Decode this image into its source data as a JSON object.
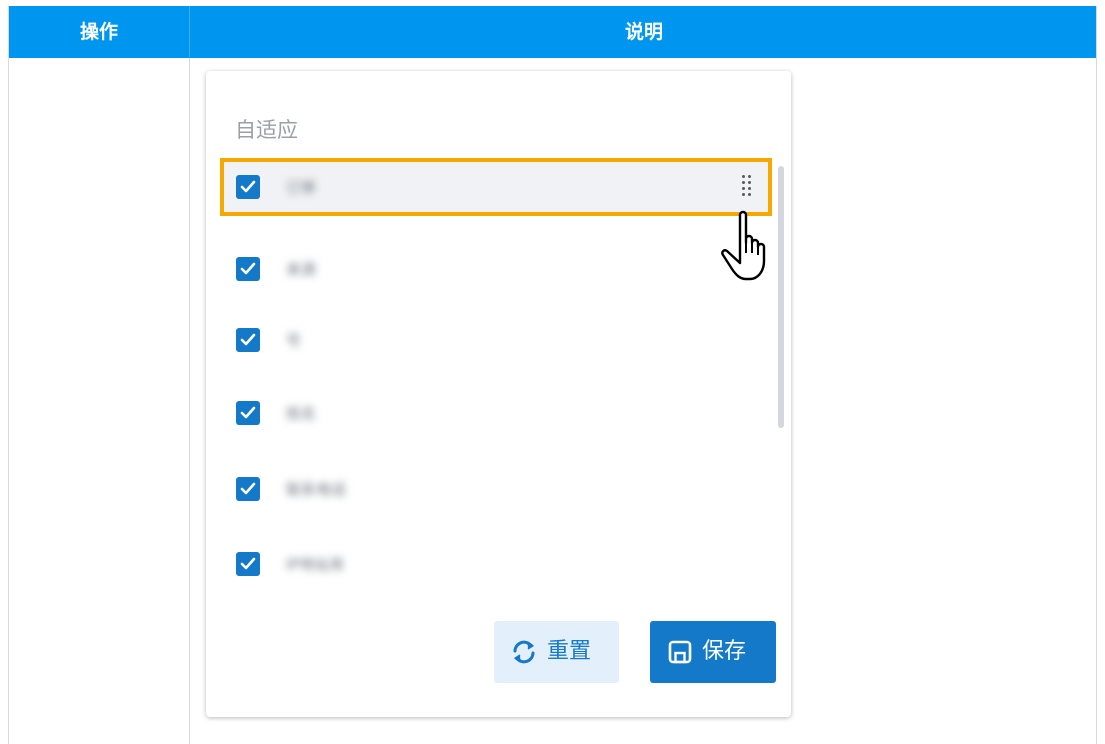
{
  "table": {
    "headers": [
      "操作",
      "说明"
    ]
  },
  "panel": {
    "title": "自适应",
    "items": [
      {
        "label": "订单",
        "checked": true,
        "highlighted": true
      },
      {
        "label": "来源",
        "checked": true,
        "highlighted": false
      },
      {
        "label": "号",
        "checked": true,
        "highlighted": false
      },
      {
        "label": "姓名",
        "checked": true,
        "highlighted": false
      },
      {
        "label": "联系电话",
        "checked": true,
        "highlighted": false
      },
      {
        "label": "IP地址库",
        "checked": true,
        "highlighted": false
      }
    ],
    "reset_label": "重置",
    "save_label": "保存"
  },
  "colors": {
    "header": "#0096f0",
    "accent": "#1479c9",
    "highlight_border": "#f5a800"
  },
  "icons": [
    "check-icon",
    "drag-handle-icon",
    "hand-pointer-cursor",
    "refresh-icon",
    "save-icon"
  ]
}
